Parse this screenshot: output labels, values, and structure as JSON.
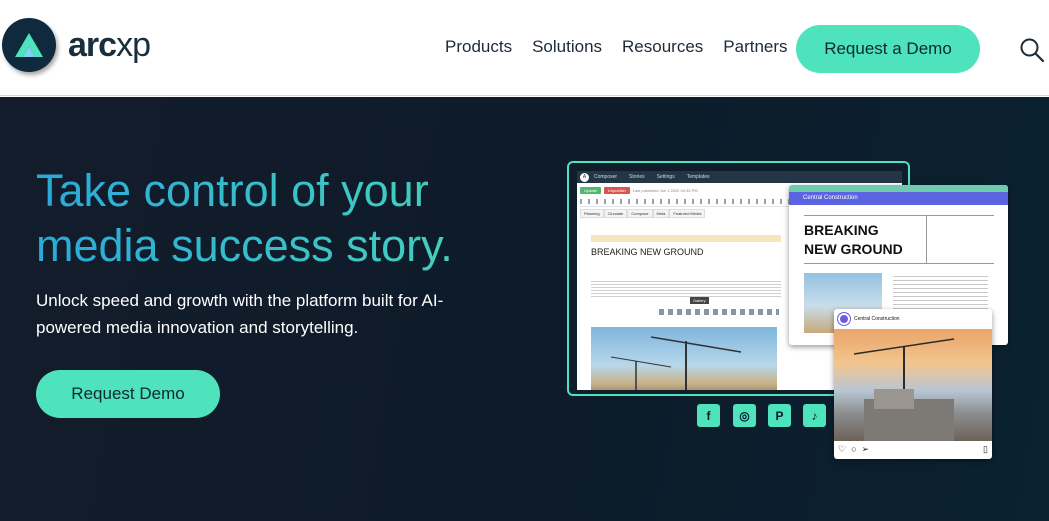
{
  "brand": {
    "name_bold": "arc",
    "name_light": "xp",
    "accent": "#4ee2bd",
    "navy": "#0e2a3c"
  },
  "nav": {
    "links": [
      "Products",
      "Solutions",
      "Resources",
      "Partners"
    ],
    "cta": "Request a Demo",
    "search_icon": "search-icon"
  },
  "hero": {
    "title": "Take control of your media success story.",
    "subtitle": "Unlock speed and growth with the platform built for AI-powered media innovation and storytelling.",
    "cta": "Request Demo"
  },
  "composer": {
    "app_name": "Composer",
    "menu": [
      "Stories",
      "Settings",
      "Templates"
    ],
    "update_label": "Update",
    "unpublish_label": "Unpublish",
    "status": "Last published Jun 1 2022 04:33 PM",
    "tabs": [
      "Planning",
      "Circulate",
      "Compose",
      "Meta",
      "Featured Media"
    ],
    "headline": "BREAKING NEW GROUND",
    "tooltip": "Gallery"
  },
  "article_card": {
    "section": "Central Construction",
    "headline_line1": "BREAKING",
    "headline_line2": "NEW GROUND"
  },
  "social_card": {
    "account": "Central Construction",
    "icons": [
      "heart-icon",
      "comment-icon",
      "share-icon",
      "bookmark-icon"
    ]
  },
  "social_links": [
    {
      "name": "facebook-icon",
      "glyph": "f"
    },
    {
      "name": "instagram-icon",
      "glyph": "◎"
    },
    {
      "name": "pinterest-icon",
      "glyph": "P"
    },
    {
      "name": "tiktok-icon",
      "glyph": "♪"
    }
  ]
}
